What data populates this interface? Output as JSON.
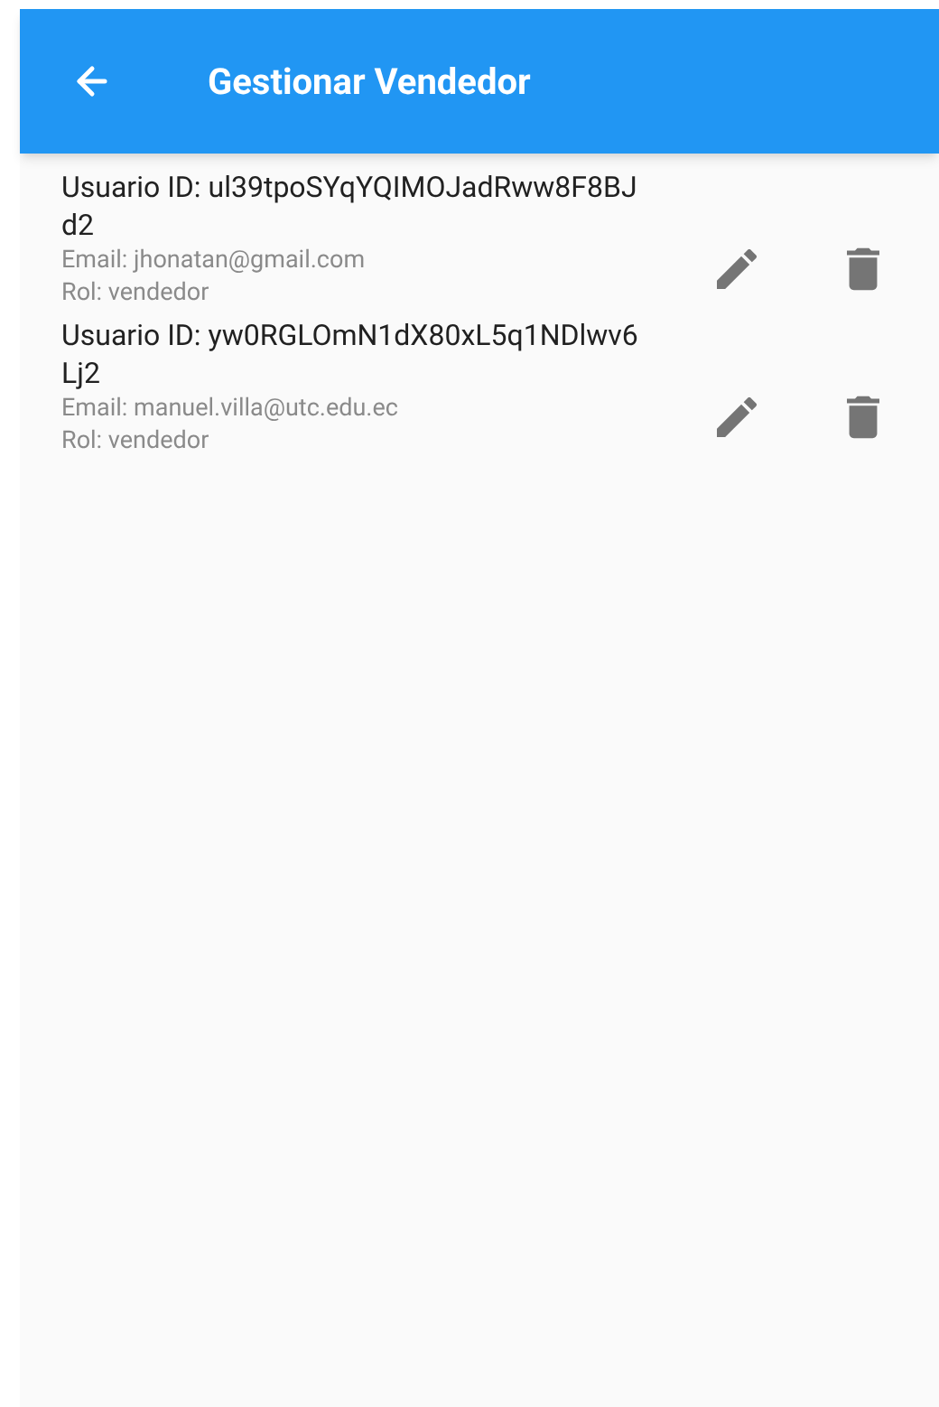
{
  "app_bar": {
    "title": "Gestionar Vendedor"
  },
  "users": [
    {
      "title": "Usuario ID: ul39tpoSYqYQIMOJadRww8F8BJd2",
      "email": "Email: jhonatan@gmail.com",
      "role": "Rol: vendedor"
    },
    {
      "title": "Usuario ID: yw0RGLOmN1dX80xL5q1NDlwv6Lj2",
      "email": "Email: manuel.villa@utc.edu.ec",
      "role": "Rol: vendedor"
    }
  ]
}
